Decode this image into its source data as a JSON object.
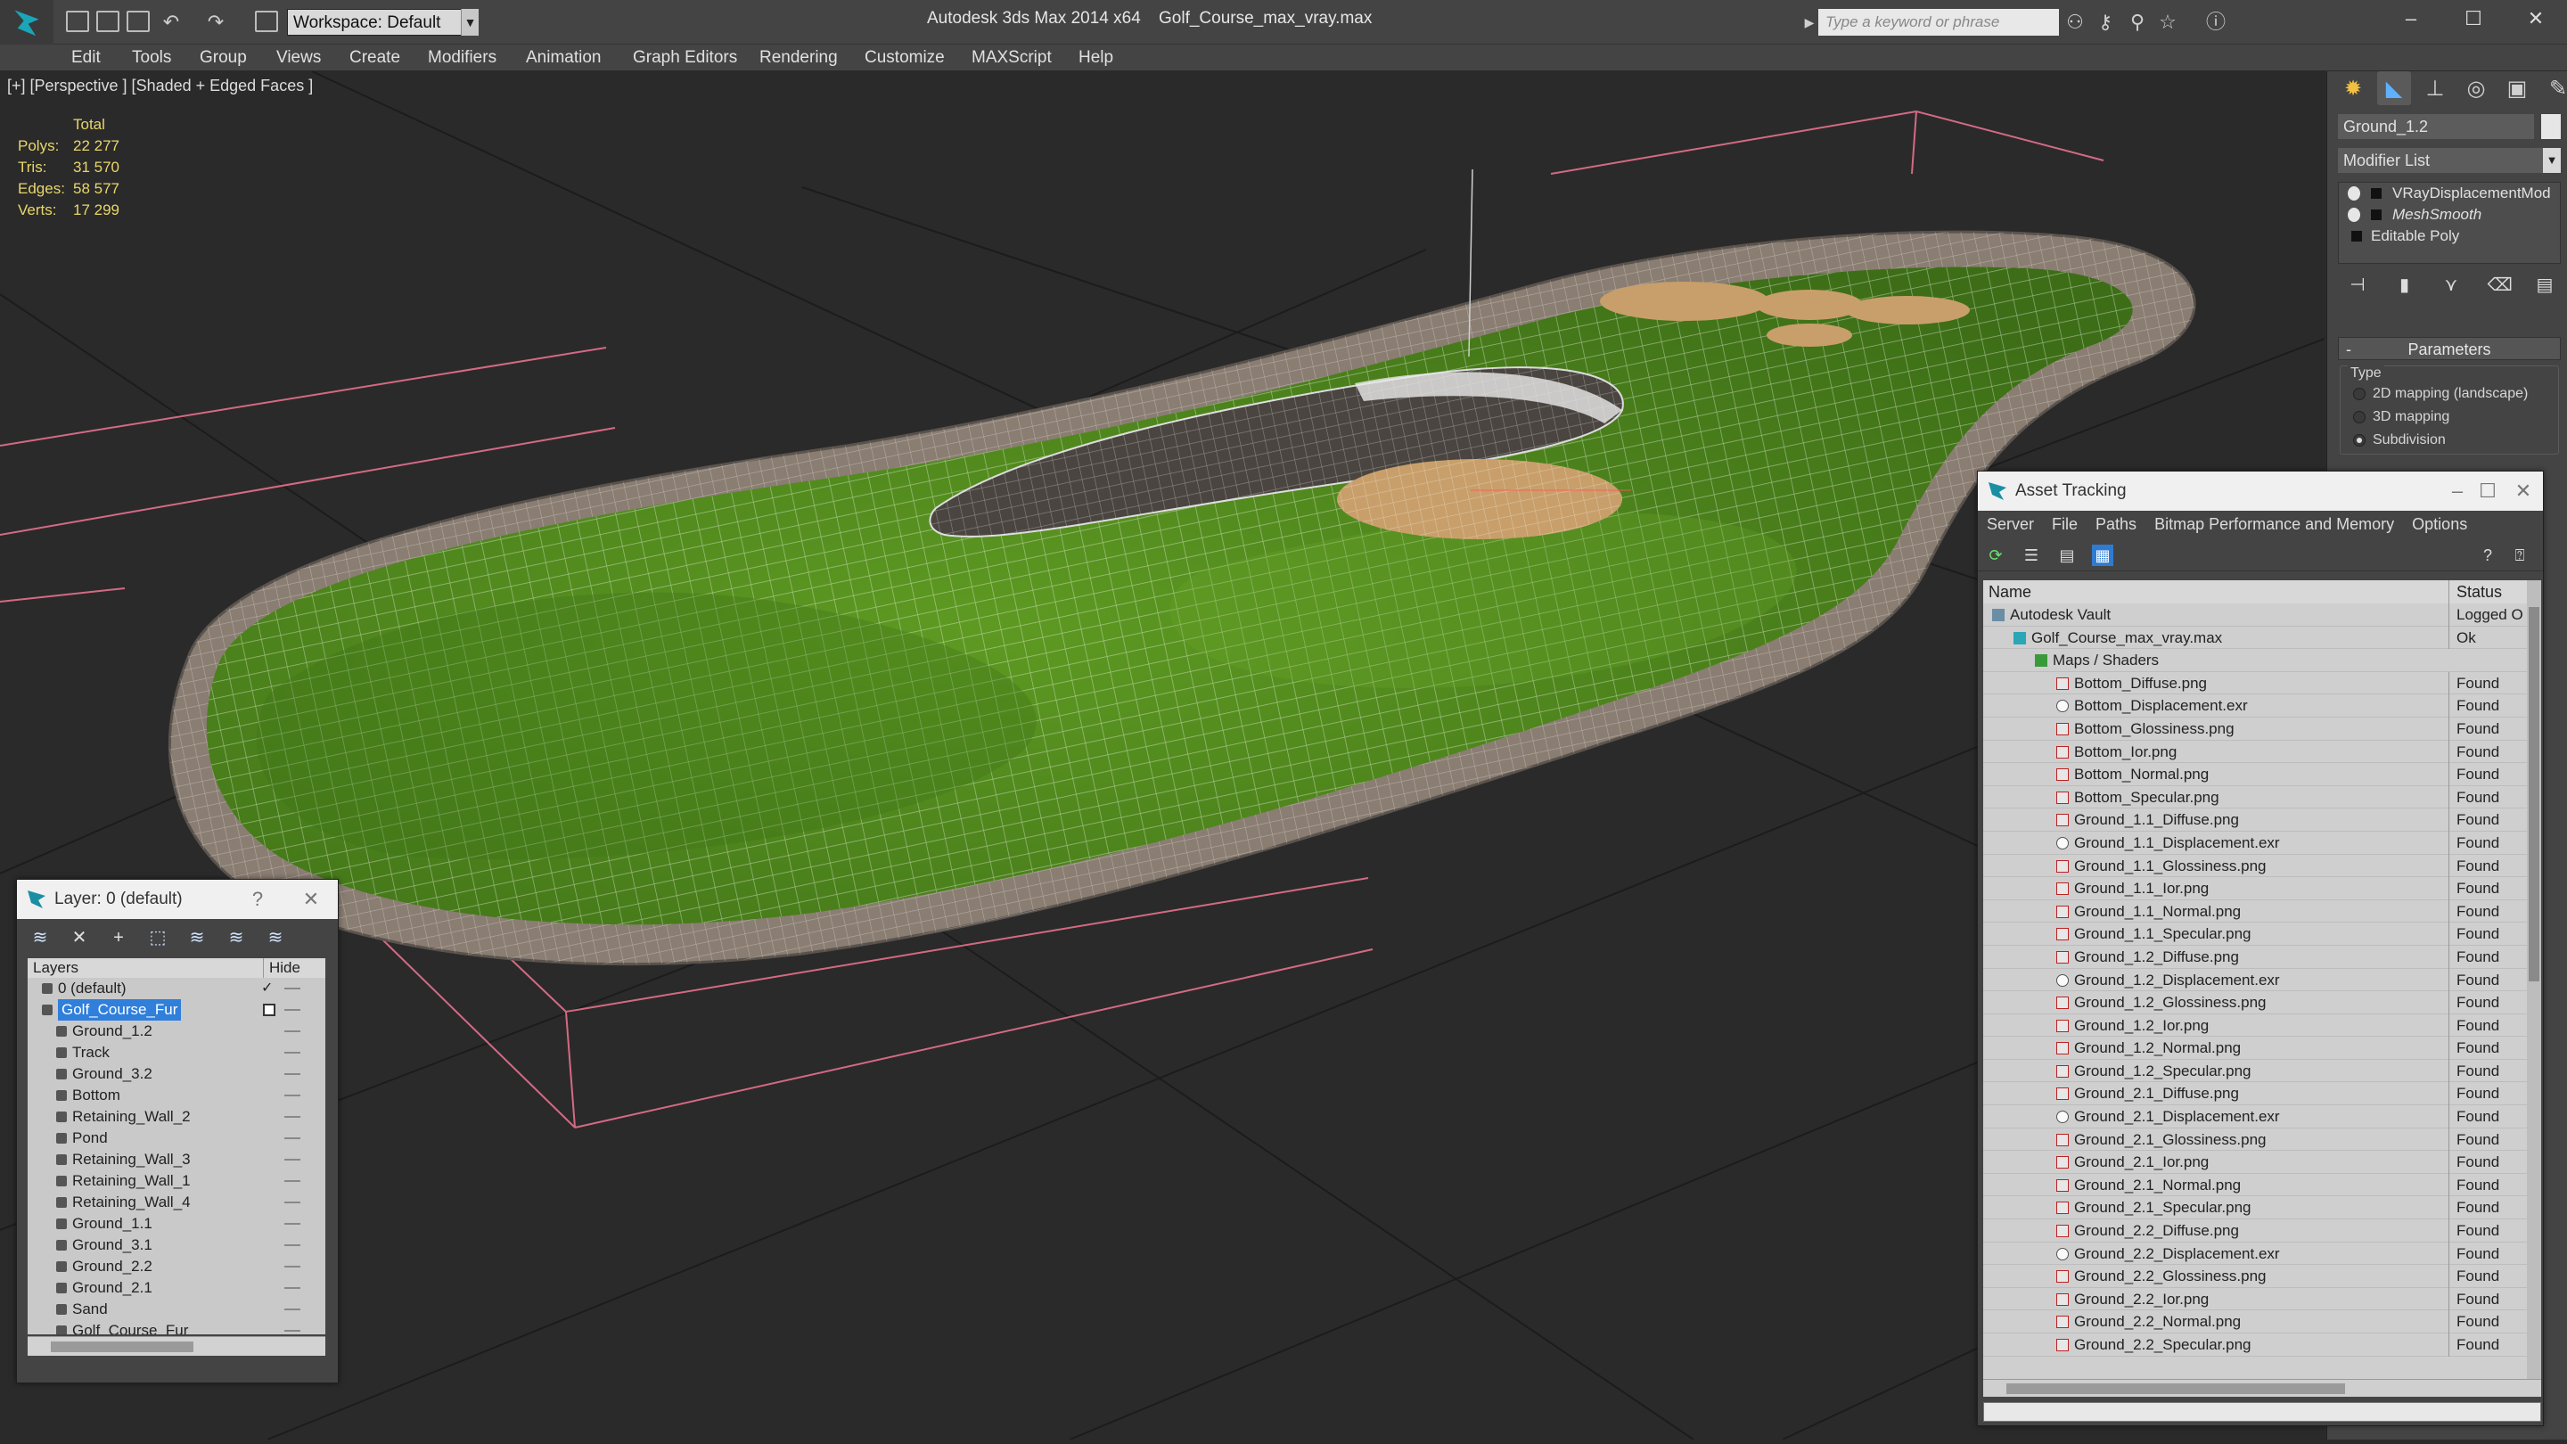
{
  "titlebar": {
    "workspace": "Workspace: Default",
    "app_title": "Autodesk 3ds Max  2014 x64",
    "file_name": "Golf_Course_max_vray.max",
    "search_placeholder": "Type a keyword or phrase"
  },
  "menu": [
    "Edit",
    "Tools",
    "Group",
    "Views",
    "Create",
    "Modifiers",
    "Animation",
    "Graph Editors",
    "Rendering",
    "Customize",
    "MAXScript",
    "Help"
  ],
  "viewport": {
    "label": "[+] [Perspective ] [Shaded + Edged Faces ]",
    "stats": {
      "header": "Total",
      "rows": [
        {
          "label": "Polys:",
          "value": "22 277"
        },
        {
          "label": "Tris:",
          "value": "31 570"
        },
        {
          "label": "Edges:",
          "value": "58 577"
        },
        {
          "label": "Verts:",
          "value": "17 299"
        }
      ]
    },
    "colors": {
      "grass": "#4f8a1e",
      "path": "#8c7f74",
      "sand": "#c8a06a",
      "wire": "#ffffff",
      "bounds": "#ff7a9c",
      "grid": "#1f1f1f"
    }
  },
  "command_panel": {
    "object_name": "Ground_1.2",
    "modifier_list": "Modifier List",
    "stack": [
      "VRayDisplacementMod",
      "MeshSmooth",
      "Editable Poly"
    ],
    "parameters_title": "Parameters",
    "type_label": "Type",
    "type_options": [
      {
        "label": "2D mapping (landscape)",
        "checked": false
      },
      {
        "label": "3D mapping",
        "checked": false
      },
      {
        "label": "Subdivision",
        "checked": true
      }
    ]
  },
  "asset_tracking": {
    "title": "Asset Tracking",
    "menu": [
      "Server",
      "File",
      "Paths",
      "Bitmap Performance and Memory",
      "Options"
    ],
    "columns": {
      "name": "Name",
      "status": "Status"
    },
    "rows": [
      {
        "name": "Autodesk Vault",
        "status": "Logged O",
        "level": 0,
        "icon": "vault"
      },
      {
        "name": "Golf_Course_max_vray.max",
        "status": "Ok",
        "level": 1,
        "icon": "max"
      },
      {
        "name": "Maps / Shaders",
        "status": "",
        "level": 2,
        "icon": "maps"
      },
      {
        "name": "Bottom_Diffuse.png",
        "status": "Found",
        "level": 3,
        "icon": "png"
      },
      {
        "name": "Bottom_Displacement.exr",
        "status": "Found",
        "level": 3,
        "icon": "exr"
      },
      {
        "name": "Bottom_Glossiness.png",
        "status": "Found",
        "level": 3,
        "icon": "png"
      },
      {
        "name": "Bottom_Ior.png",
        "status": "Found",
        "level": 3,
        "icon": "png"
      },
      {
        "name": "Bottom_Normal.png",
        "status": "Found",
        "level": 3,
        "icon": "png"
      },
      {
        "name": "Bottom_Specular.png",
        "status": "Found",
        "level": 3,
        "icon": "png"
      },
      {
        "name": "Ground_1.1_Diffuse.png",
        "status": "Found",
        "level": 3,
        "icon": "png"
      },
      {
        "name": "Ground_1.1_Displacement.exr",
        "status": "Found",
        "level": 3,
        "icon": "exr"
      },
      {
        "name": "Ground_1.1_Glossiness.png",
        "status": "Found",
        "level": 3,
        "icon": "png"
      },
      {
        "name": "Ground_1.1_Ior.png",
        "status": "Found",
        "level": 3,
        "icon": "png"
      },
      {
        "name": "Ground_1.1_Normal.png",
        "status": "Found",
        "level": 3,
        "icon": "png"
      },
      {
        "name": "Ground_1.1_Specular.png",
        "status": "Found",
        "level": 3,
        "icon": "png"
      },
      {
        "name": "Ground_1.2_Diffuse.png",
        "status": "Found",
        "level": 3,
        "icon": "png"
      },
      {
        "name": "Ground_1.2_Displacement.exr",
        "status": "Found",
        "level": 3,
        "icon": "exr"
      },
      {
        "name": "Ground_1.2_Glossiness.png",
        "status": "Found",
        "level": 3,
        "icon": "png"
      },
      {
        "name": "Ground_1.2_Ior.png",
        "status": "Found",
        "level": 3,
        "icon": "png"
      },
      {
        "name": "Ground_1.2_Normal.png",
        "status": "Found",
        "level": 3,
        "icon": "png"
      },
      {
        "name": "Ground_1.2_Specular.png",
        "status": "Found",
        "level": 3,
        "icon": "png"
      },
      {
        "name": "Ground_2.1_Diffuse.png",
        "status": "Found",
        "level": 3,
        "icon": "png"
      },
      {
        "name": "Ground_2.1_Displacement.exr",
        "status": "Found",
        "level": 3,
        "icon": "exr"
      },
      {
        "name": "Ground_2.1_Glossiness.png",
        "status": "Found",
        "level": 3,
        "icon": "png"
      },
      {
        "name": "Ground_2.1_Ior.png",
        "status": "Found",
        "level": 3,
        "icon": "png"
      },
      {
        "name": "Ground_2.1_Normal.png",
        "status": "Found",
        "level": 3,
        "icon": "png"
      },
      {
        "name": "Ground_2.1_Specular.png",
        "status": "Found",
        "level": 3,
        "icon": "png"
      },
      {
        "name": "Ground_2.2_Diffuse.png",
        "status": "Found",
        "level": 3,
        "icon": "png"
      },
      {
        "name": "Ground_2.2_Displacement.exr",
        "status": "Found",
        "level": 3,
        "icon": "exr"
      },
      {
        "name": "Ground_2.2_Glossiness.png",
        "status": "Found",
        "level": 3,
        "icon": "png"
      },
      {
        "name": "Ground_2.2_Ior.png",
        "status": "Found",
        "level": 3,
        "icon": "png"
      },
      {
        "name": "Ground_2.2_Normal.png",
        "status": "Found",
        "level": 3,
        "icon": "png"
      },
      {
        "name": "Ground_2.2_Specular.png",
        "status": "Found",
        "level": 3,
        "icon": "png"
      }
    ]
  },
  "layer_manager": {
    "title": "Layer: 0 (default)",
    "help": "?",
    "columns": {
      "layers": "Layers",
      "hide": "Hide"
    },
    "rows": [
      {
        "name": "0 (default)",
        "level": 0,
        "current": true
      },
      {
        "name": "Golf_Course_Fur",
        "level": 0,
        "selected": true
      },
      {
        "name": "Ground_1.2",
        "level": 1
      },
      {
        "name": "Track",
        "level": 1
      },
      {
        "name": "Ground_3.2",
        "level": 1
      },
      {
        "name": "Bottom",
        "level": 1
      },
      {
        "name": "Retaining_Wall_2",
        "level": 1
      },
      {
        "name": "Pond",
        "level": 1
      },
      {
        "name": "Retaining_Wall_3",
        "level": 1
      },
      {
        "name": "Retaining_Wall_1",
        "level": 1
      },
      {
        "name": "Retaining_Wall_4",
        "level": 1
      },
      {
        "name": "Ground_1.1",
        "level": 1
      },
      {
        "name": "Ground_3.1",
        "level": 1
      },
      {
        "name": "Ground_2.2",
        "level": 1
      },
      {
        "name": "Ground_2.1",
        "level": 1
      },
      {
        "name": "Sand",
        "level": 1
      },
      {
        "name": "Golf_Course_Fur",
        "level": 1
      }
    ]
  }
}
